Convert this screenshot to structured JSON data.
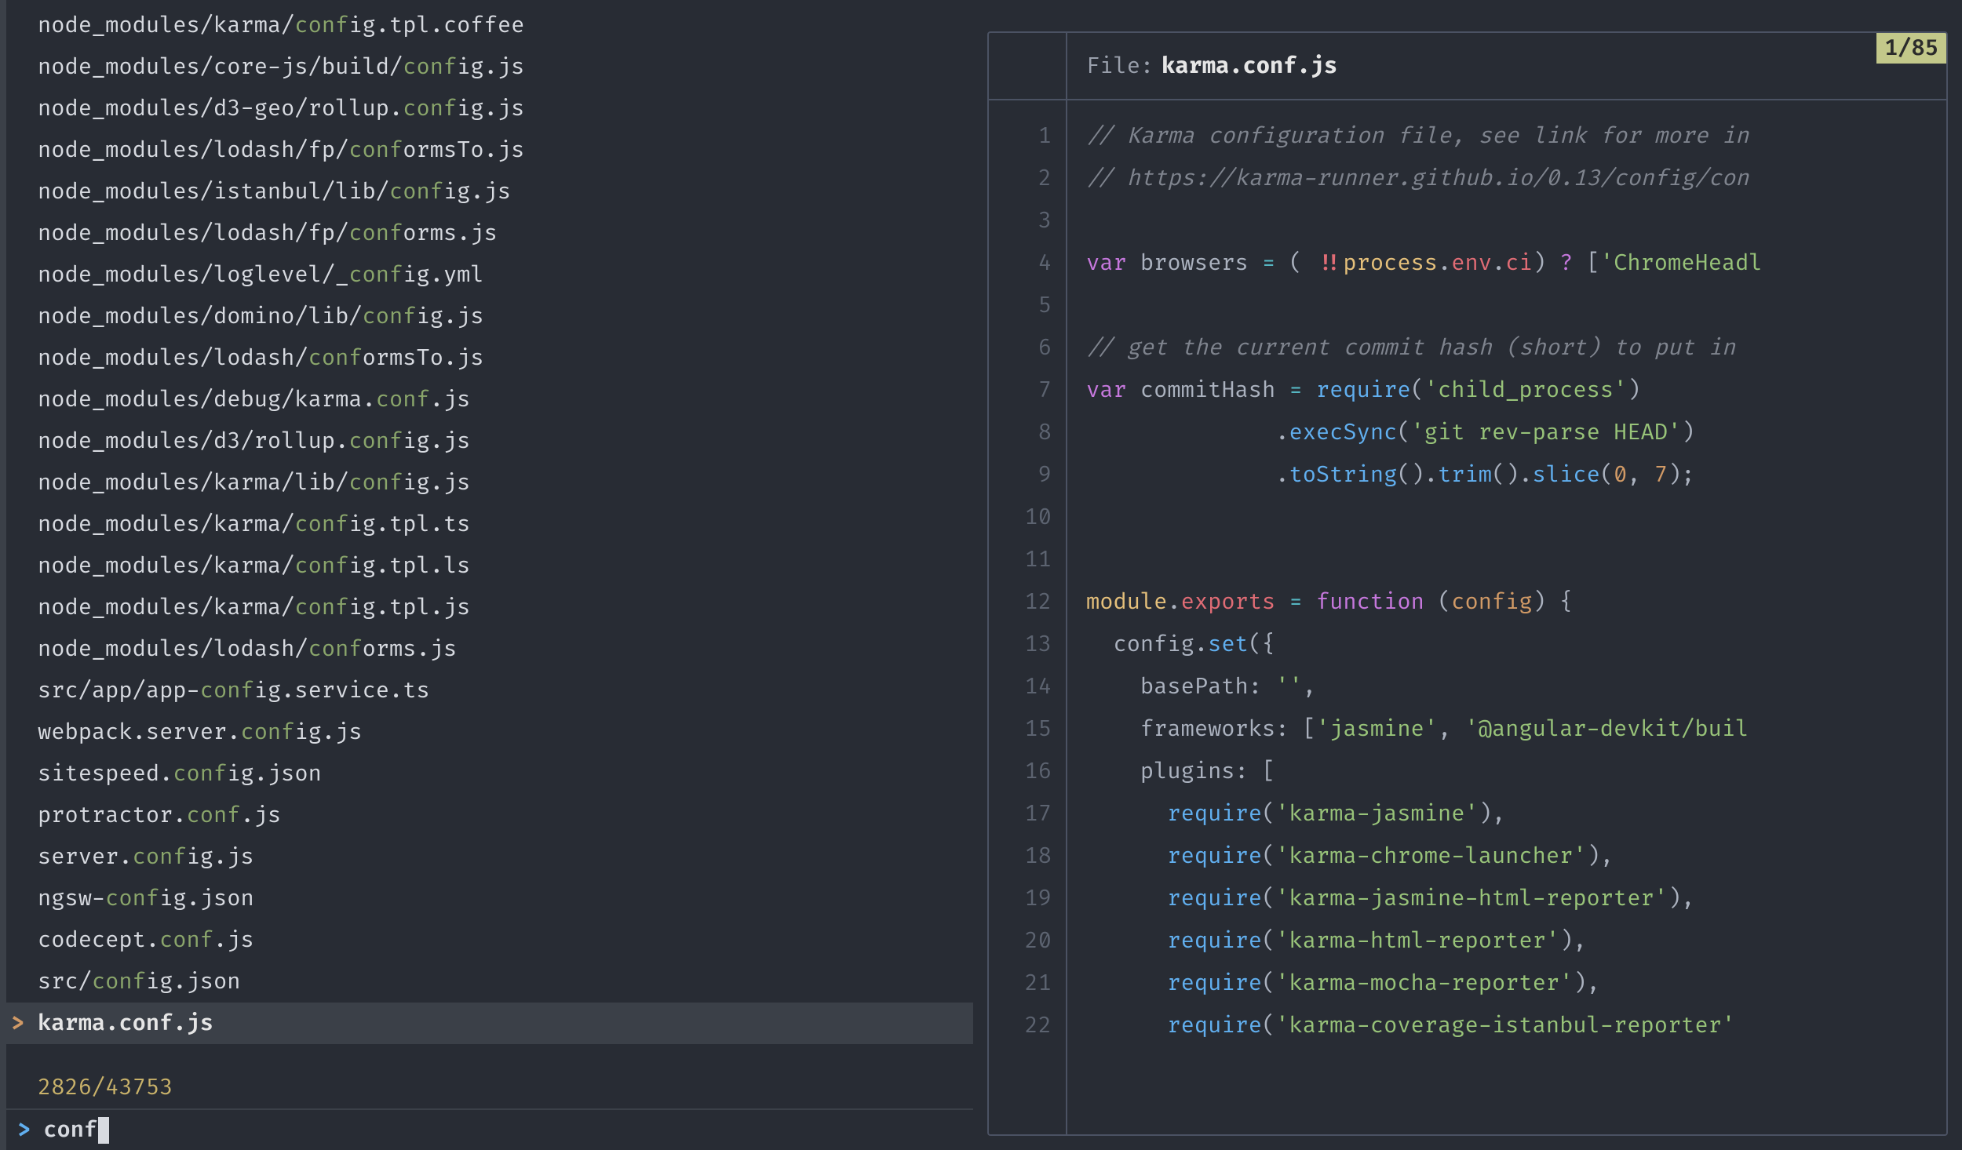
{
  "query": "conf",
  "match_count": "2826/43753",
  "preview_position": "1/85",
  "selected_index": 24,
  "file_list": [
    {
      "pre": "node_modules/karma/",
      "match": "conf",
      "post": "ig.tpl.coffee"
    },
    {
      "pre": "node_modules/core-js/build/",
      "match": "conf",
      "post": "ig.js"
    },
    {
      "pre": "node_modules/d3-geo/rollup.",
      "match": "conf",
      "post": "ig.js"
    },
    {
      "pre": "node_modules/lodash/fp/",
      "match": "conf",
      "post": "ormsTo.js"
    },
    {
      "pre": "node_modules/istanbul/lib/",
      "match": "conf",
      "post": "ig.js"
    },
    {
      "pre": "node_modules/lodash/fp/",
      "match": "conf",
      "post": "orms.js"
    },
    {
      "pre": "node_modules/loglevel/_",
      "match": "conf",
      "post": "ig.yml"
    },
    {
      "pre": "node_modules/domino/lib/",
      "match": "conf",
      "post": "ig.js"
    },
    {
      "pre": "node_modules/lodash/",
      "match": "conf",
      "post": "ormsTo.js"
    },
    {
      "pre": "node_modules/debug/karma.",
      "match": "conf",
      "post": ".js"
    },
    {
      "pre": "node_modules/d3/rollup.",
      "match": "conf",
      "post": "ig.js"
    },
    {
      "pre": "node_modules/karma/lib/",
      "match": "conf",
      "post": "ig.js"
    },
    {
      "pre": "node_modules/karma/",
      "match": "conf",
      "post": "ig.tpl.ts"
    },
    {
      "pre": "node_modules/karma/",
      "match": "conf",
      "post": "ig.tpl.ls"
    },
    {
      "pre": "node_modules/karma/",
      "match": "conf",
      "post": "ig.tpl.js"
    },
    {
      "pre": "node_modules/lodash/",
      "match": "conf",
      "post": "orms.js"
    },
    {
      "pre": "src/app/app-",
      "match": "conf",
      "post": "ig.service.ts"
    },
    {
      "pre": "webpack.server.",
      "match": "conf",
      "post": "ig.js"
    },
    {
      "pre": "sitespeed.",
      "match": "conf",
      "post": "ig.json"
    },
    {
      "pre": "protractor.",
      "match": "conf",
      "post": ".js"
    },
    {
      "pre": "server.",
      "match": "conf",
      "post": "ig.js"
    },
    {
      "pre": "ngsw-",
      "match": "conf",
      "post": "ig.json"
    },
    {
      "pre": "codecept.",
      "match": "conf",
      "post": ".js"
    },
    {
      "pre": "src/",
      "match": "conf",
      "post": "ig.json"
    },
    {
      "pre": "karma.",
      "match": "conf",
      "post": ".js"
    }
  ],
  "preview": {
    "header_label": "File: ",
    "filename": "karma.conf.js",
    "lines": [
      [
        {
          "cls": "c-comment",
          "t": "// Karma configuration file, see link for more in"
        }
      ],
      [
        {
          "cls": "c-comment",
          "t": "// https://karma-runner.github.io/0.13/config/con"
        }
      ],
      [],
      [
        {
          "cls": "c-kw",
          "t": "var"
        },
        {
          "cls": "c-plain",
          "t": " browsers "
        },
        {
          "cls": "c-op",
          "t": "="
        },
        {
          "cls": "c-plain",
          "t": " ( "
        },
        {
          "cls": "c-bang",
          "t": "!!"
        },
        {
          "cls": "c-obj",
          "t": "process"
        },
        {
          "cls": "c-plain",
          "t": "."
        },
        {
          "cls": "c-prop",
          "t": "env"
        },
        {
          "cls": "c-plain",
          "t": "."
        },
        {
          "cls": "c-prop",
          "t": "ci"
        },
        {
          "cls": "c-plain",
          "t": ") "
        },
        {
          "cls": "c-kw",
          "t": "?"
        },
        {
          "cls": "c-plain",
          "t": " ["
        },
        {
          "cls": "c-str",
          "t": "'ChromeHeadl"
        }
      ],
      [],
      [
        {
          "cls": "c-comment",
          "t": "// get the current commit hash (short) to put in "
        }
      ],
      [
        {
          "cls": "c-kw",
          "t": "var"
        },
        {
          "cls": "c-plain",
          "t": " commitHash "
        },
        {
          "cls": "c-op",
          "t": "="
        },
        {
          "cls": "c-plain",
          "t": " "
        },
        {
          "cls": "c-fn",
          "t": "require"
        },
        {
          "cls": "c-plain",
          "t": "("
        },
        {
          "cls": "c-str",
          "t": "'child_process'"
        },
        {
          "cls": "c-plain",
          "t": ")"
        }
      ],
      [
        {
          "cls": "c-plain",
          "t": "              ."
        },
        {
          "cls": "c-fn",
          "t": "execSync"
        },
        {
          "cls": "c-plain",
          "t": "("
        },
        {
          "cls": "c-str",
          "t": "'git rev-parse HEAD'"
        },
        {
          "cls": "c-plain",
          "t": ")"
        }
      ],
      [
        {
          "cls": "c-plain",
          "t": "              ."
        },
        {
          "cls": "c-fn",
          "t": "toString"
        },
        {
          "cls": "c-plain",
          "t": "()."
        },
        {
          "cls": "c-fn",
          "t": "trim"
        },
        {
          "cls": "c-plain",
          "t": "()."
        },
        {
          "cls": "c-fn",
          "t": "slice"
        },
        {
          "cls": "c-plain",
          "t": "("
        },
        {
          "cls": "c-num",
          "t": "0"
        },
        {
          "cls": "c-plain",
          "t": ", "
        },
        {
          "cls": "c-num",
          "t": "7"
        },
        {
          "cls": "c-plain",
          "t": ");"
        }
      ],
      [],
      [],
      [
        {
          "cls": "c-obj",
          "t": "module"
        },
        {
          "cls": "c-plain",
          "t": "."
        },
        {
          "cls": "c-prop",
          "t": "exports"
        },
        {
          "cls": "c-plain",
          "t": " "
        },
        {
          "cls": "c-op",
          "t": "="
        },
        {
          "cls": "c-plain",
          "t": " "
        },
        {
          "cls": "c-kw",
          "t": "function"
        },
        {
          "cls": "c-plain",
          "t": " ("
        },
        {
          "cls": "c-attr",
          "t": "config"
        },
        {
          "cls": "c-plain",
          "t": ") {"
        }
      ],
      [
        {
          "cls": "c-plain",
          "t": "  "
        },
        {
          "cls": "c-ident",
          "t": "config"
        },
        {
          "cls": "c-plain",
          "t": "."
        },
        {
          "cls": "c-fn",
          "t": "set"
        },
        {
          "cls": "c-plain",
          "t": "({"
        }
      ],
      [
        {
          "cls": "c-plain",
          "t": "    basePath: "
        },
        {
          "cls": "c-str",
          "t": "''"
        },
        {
          "cls": "c-plain",
          "t": ","
        }
      ],
      [
        {
          "cls": "c-plain",
          "t": "    frameworks: ["
        },
        {
          "cls": "c-str",
          "t": "'jasmine'"
        },
        {
          "cls": "c-plain",
          "t": ", "
        },
        {
          "cls": "c-str",
          "t": "'@angular-devkit/buil"
        }
      ],
      [
        {
          "cls": "c-plain",
          "t": "    plugins: ["
        }
      ],
      [
        {
          "cls": "c-plain",
          "t": "      "
        },
        {
          "cls": "c-fn",
          "t": "require"
        },
        {
          "cls": "c-plain",
          "t": "("
        },
        {
          "cls": "c-str",
          "t": "'karma-jasmine'"
        },
        {
          "cls": "c-plain",
          "t": "),"
        }
      ],
      [
        {
          "cls": "c-plain",
          "t": "      "
        },
        {
          "cls": "c-fn",
          "t": "require"
        },
        {
          "cls": "c-plain",
          "t": "("
        },
        {
          "cls": "c-str",
          "t": "'karma-chrome-launcher'"
        },
        {
          "cls": "c-plain",
          "t": "),"
        }
      ],
      [
        {
          "cls": "c-plain",
          "t": "      "
        },
        {
          "cls": "c-fn",
          "t": "require"
        },
        {
          "cls": "c-plain",
          "t": "("
        },
        {
          "cls": "c-str",
          "t": "'karma-jasmine-html-reporter'"
        },
        {
          "cls": "c-plain",
          "t": "),"
        }
      ],
      [
        {
          "cls": "c-plain",
          "t": "      "
        },
        {
          "cls": "c-fn",
          "t": "require"
        },
        {
          "cls": "c-plain",
          "t": "("
        },
        {
          "cls": "c-str",
          "t": "'karma-html-reporter'"
        },
        {
          "cls": "c-plain",
          "t": "),"
        }
      ],
      [
        {
          "cls": "c-plain",
          "t": "      "
        },
        {
          "cls": "c-fn",
          "t": "require"
        },
        {
          "cls": "c-plain",
          "t": "("
        },
        {
          "cls": "c-str",
          "t": "'karma-mocha-reporter'"
        },
        {
          "cls": "c-plain",
          "t": "),"
        }
      ],
      [
        {
          "cls": "c-plain",
          "t": "      "
        },
        {
          "cls": "c-fn",
          "t": "require"
        },
        {
          "cls": "c-plain",
          "t": "("
        },
        {
          "cls": "c-str",
          "t": "'karma-coverage-istanbul-reporter'"
        }
      ]
    ]
  }
}
